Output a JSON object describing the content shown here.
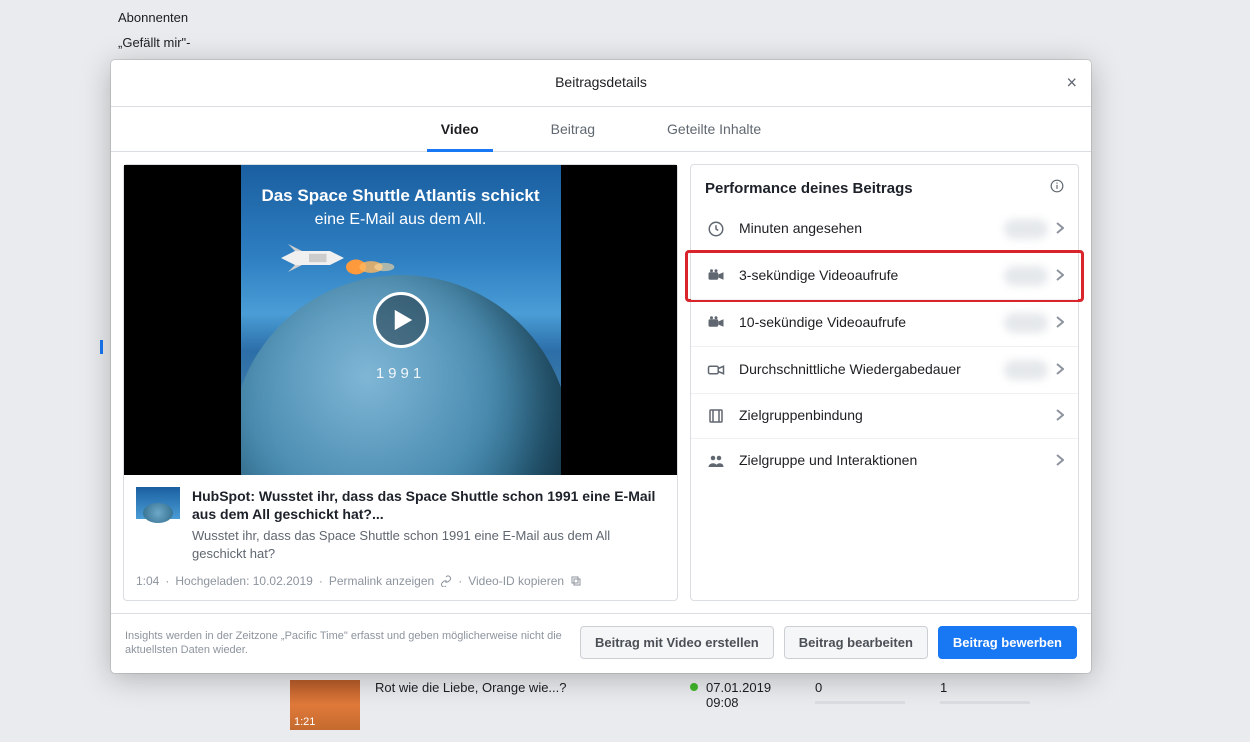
{
  "background": {
    "sidebar": {
      "items": [
        "Abonnenten",
        "„Gefällt mir\"-"
      ]
    },
    "row": {
      "thumb_duration": "1:21",
      "title": "Rot wie die Liebe, Orange wie...?",
      "date": "07.01.2019",
      "time": "09:08",
      "col1": "0",
      "col2": "1"
    }
  },
  "modal": {
    "title": "Beitragsdetails",
    "close": "×",
    "tabs": [
      "Video",
      "Beitrag",
      "Geteilte Inhalte"
    ],
    "video": {
      "headline_top": "Das Space Shuttle Atlantis schickt",
      "headline_sub": "eine E-Mail aus dem All.",
      "year": "1991"
    },
    "post": {
      "title": "HubSpot: Wusstet ihr, dass das Space Shuttle schon 1991 eine E-Mail aus dem All geschickt hat?...",
      "subtitle": "Wusstet ihr, dass das Space Shuttle schon 1991 eine E-Mail aus dem All geschickt hat?"
    },
    "footer_meta": {
      "duration": "1:04",
      "uploaded": "Hochgeladen: 10.02.2019",
      "permalink": "Permalink anzeigen",
      "copy_id": "Video-ID kopieren"
    },
    "performance": {
      "title": "Performance deines Beitrags",
      "metrics": [
        {
          "label": "Minuten angesehen",
          "icon": "clock",
          "blur": true,
          "chev": true
        },
        {
          "label": "3-sekündige Videoaufrufe",
          "icon": "camera",
          "blur": true,
          "chev": true,
          "highlight": true
        },
        {
          "label": "10-sekündige Videoaufrufe",
          "icon": "camera",
          "blur": true,
          "chev": true
        },
        {
          "label": "Durchschnittliche Wiedergabedauer",
          "icon": "video-outline",
          "blur": true,
          "chev": true
        },
        {
          "label": "Zielgruppenbindung",
          "icon": "film",
          "blur": false,
          "chev": true
        },
        {
          "label": "Zielgruppe und Interaktionen",
          "icon": "people",
          "blur": false,
          "chev": true
        }
      ]
    },
    "footer": {
      "note": "Insights werden in der Zeitzone „Pacific Time\" erfasst und geben möglicherweise nicht die aktuellsten Daten wieder.",
      "btn_create": "Beitrag mit Video erstellen",
      "btn_edit": "Beitrag bearbeiten",
      "btn_promote": "Beitrag bewerben"
    }
  }
}
